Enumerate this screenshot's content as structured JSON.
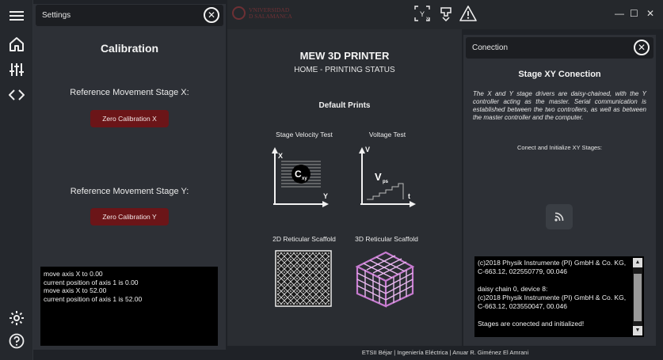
{
  "rail": {
    "icons": [
      "menu-icon",
      "home-icon",
      "sliders-icon",
      "code-icon",
      "gear-icon",
      "help-icon"
    ]
  },
  "settings": {
    "header": "Settings",
    "title": "Calibration",
    "ref_x": "Reference Movement Stage X:",
    "zero_x": "Zero Calibration X",
    "ref_y": "Reference Movement Stage Y:",
    "zero_y": "Zero Calibration Y",
    "log": "move axis X to 0.00\ncurrent position of axis 1 is 0.00\nmove axis X to 52.00\ncurrent position of axis 1 is 52.00"
  },
  "topbar": {
    "logo_line1": "VNIVERSIDAD",
    "logo_line2": "D SALAMANCA",
    "window_min": "—",
    "window_max": "☐",
    "window_close": "✕"
  },
  "main": {
    "title": "MEW 3D PRINTER",
    "subtitle": "HOME - PRINTING STATUS",
    "section": "Default Prints",
    "prints": [
      {
        "label": "Stage Velocity Test",
        "axis_x": "Y",
        "axis_y": "X",
        "badge": "C",
        "badge_sub": "xy"
      },
      {
        "label": "Voltage Test",
        "axis_x": "t",
        "axis_y": "V",
        "badge": "V",
        "badge_sub": "ps"
      },
      {
        "label": "2D Reticular Scaffold"
      },
      {
        "label": "3D Reticular Scaffold"
      }
    ]
  },
  "footer": "ETSII Béjar | Ingeniería Eléctrica | Anuar R. Giménez El Amrani",
  "connection": {
    "header": "Conection",
    "title": "Stage XY Conection",
    "description": "The X and Y stage drivers are daisy-chained, with the Y controller acting as the master. Serial communication is established between the two controllers, as well as between the master controller and the computer.",
    "connect_label": "Conect and Initialize XY Stages:",
    "log": "(c)2018 Physik Instrumente (PI) GmbH & Co. KG, C-663.12, 022550779, 00.046\n\ndaisy chain 0, device 8:\n(c)2018 Physik Instrumente (PI) GmbH & Co. KG, C-663.12, 023550047, 00.046\n\nStages are conected and initialized!"
  },
  "colors": {
    "accent_red": "#6b1518",
    "panel": "#2d3036",
    "background": "#1f2227"
  }
}
